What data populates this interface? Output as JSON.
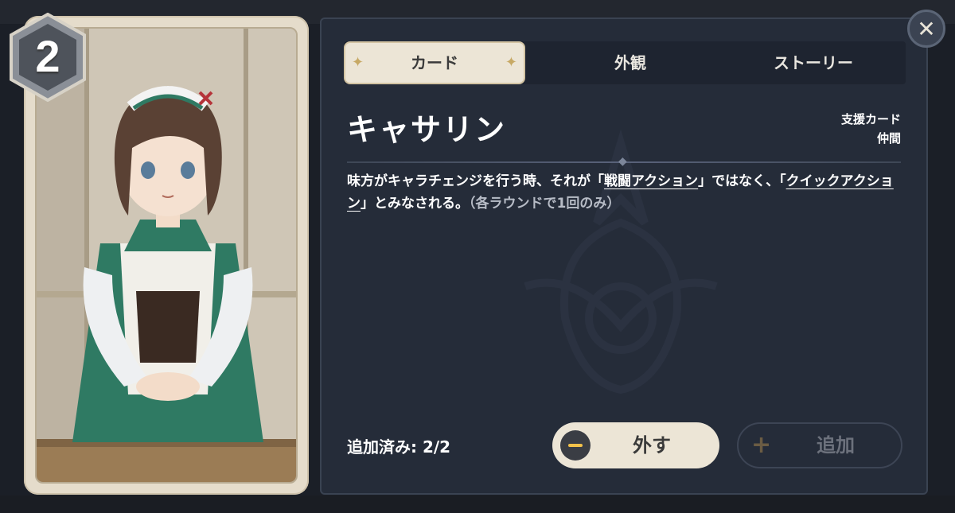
{
  "card": {
    "cost": "2",
    "name": "キャサリン",
    "type_line_1": "支援カード",
    "type_line_2": "仲間"
  },
  "tabs": [
    {
      "label": "カード",
      "active": true
    },
    {
      "label": "外観",
      "active": false
    },
    {
      "label": "ストーリー",
      "active": false
    }
  ],
  "description": {
    "part1": "味方がキャラチェンジを行う時、それが「",
    "kw1": "戦闘アクション",
    "part2": "」ではなく、「",
    "kw2": "クイックアクション",
    "part3": "」とみなされる。",
    "note": "（各ラウンドで1回のみ）"
  },
  "deck": {
    "added_label": "追加済み: 2/2",
    "remove_label": "外す",
    "add_label": "追加"
  },
  "icons": {
    "close": "close-icon",
    "minus": "minus-icon",
    "plus": "plus-icon"
  },
  "colors": {
    "panel_bg": "#252c39",
    "active_tab_bg": "#ece5d6",
    "accent_gold": "#c7a965",
    "minus_icon": "#f2c14a"
  }
}
